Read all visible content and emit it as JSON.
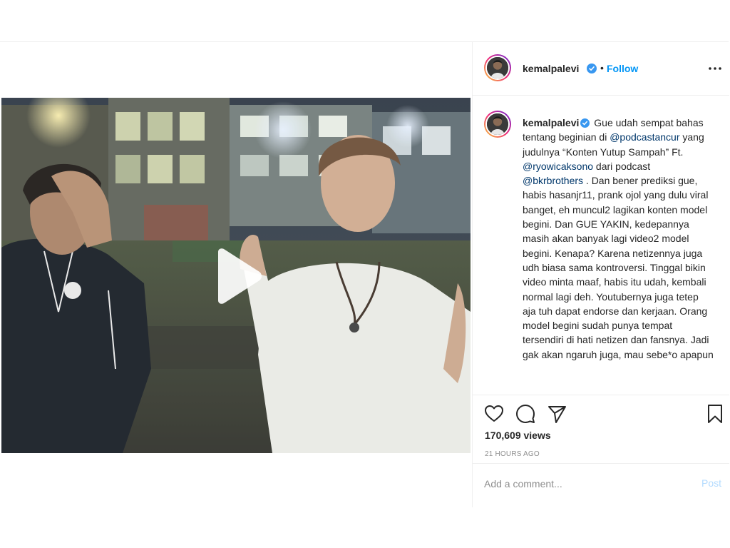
{
  "post": {
    "username": "kemalpalevi",
    "verified_icon": "verified-badge-icon",
    "separator": "•",
    "follow_label": "Follow",
    "more_icon": "more-options-icon"
  },
  "caption": {
    "username": "kemalpalevi",
    "text_1": "Gue udah sempat bahas tentang beginian di ",
    "mention_1": "@podcastancur",
    "text_2": " yang judulnya “Konten Yutup Sampah” Ft. ",
    "mention_2": "@ryowicaksono",
    "text_3": " dari podcast ",
    "mention_3": "@bkrbrothers",
    "text_4": " . Dan bener prediksi gue, habis hasanjr11, prank ojol yang dulu viral banget, eh muncul2 lagikan konten model begini. Dan GUE YAKIN, kedepannya masih akan banyak lagi video2 model begini. Kenapa? Karena netizennya juga udh biasa sama kontroversi. Tinggal bikin video minta maaf, habis itu udah, kembali normal lagi deh. Youtubernya juga tetep aja tuh dapat endorse dan kerjaan. Orang model begini sudah punya tempat tersendiri di hati netizen dan fansnya. Jadi gak akan ngaruh juga, mau sebe*o apapun"
  },
  "stats": {
    "views": "170,609 views",
    "time_ago": "21 HOURS AGO"
  },
  "comment": {
    "placeholder": "Add a comment...",
    "post_label": "Post"
  },
  "icons": {
    "play": "play-icon",
    "like": "heart-icon",
    "comment": "comment-icon",
    "share": "share-icon",
    "save": "bookmark-icon"
  },
  "colors": {
    "link_blue": "#0095f6",
    "mention": "#00376b",
    "muted": "#8e8e8e",
    "post_disabled": "#b3dbff"
  }
}
